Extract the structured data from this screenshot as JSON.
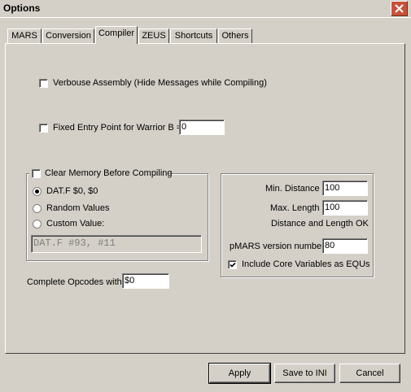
{
  "window": {
    "title": "Options",
    "close_icon": "close-icon"
  },
  "tabs": [
    {
      "label": "MARS",
      "active": false
    },
    {
      "label": "Conversion",
      "active": false
    },
    {
      "label": "Compiler",
      "active": true
    },
    {
      "label": "ZEUS",
      "active": false
    },
    {
      "label": "Shortcuts",
      "active": false
    },
    {
      "label": "Others",
      "active": false
    }
  ],
  "compiler": {
    "verbose_label": "Verbouse Assembly (Hide Messages while Compiling)",
    "verbose_checked": false,
    "fixed_entry_label": "Fixed Entry Point for Warrior B =",
    "fixed_entry_checked": false,
    "fixed_entry_value": "0",
    "clear_memory": {
      "label": "Clear Memory Before Compiling",
      "checked": false,
      "options": [
        {
          "label": "DAT.F $0, $0",
          "selected": true
        },
        {
          "label": "Random Values",
          "selected": false
        },
        {
          "label": "Custom Value:",
          "selected": false
        }
      ],
      "custom_value": "DAT.F #93, #11"
    },
    "distance": {
      "min_label": "Min. Distance",
      "min_value": "100",
      "max_label": "Max. Length",
      "max_value": "100",
      "status": "Distance and Length OK",
      "pmars_label": "pMARS version number",
      "pmars_value": "80",
      "include_core_label": "Include Core Variables as EQUs",
      "include_core_checked": true
    },
    "complete_opcodes_label": "Complete Opcodes with",
    "complete_opcodes_value": "$0"
  },
  "buttons": {
    "apply": "Apply",
    "save": "Save to INI",
    "cancel": "Cancel"
  }
}
